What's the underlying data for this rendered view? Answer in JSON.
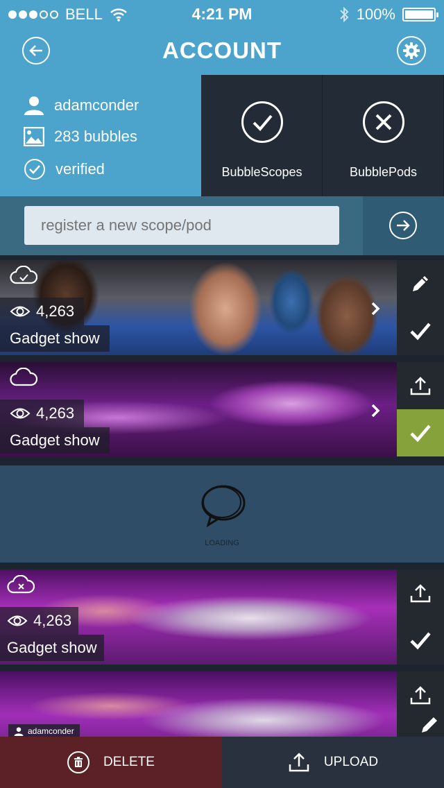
{
  "status_bar": {
    "carrier": "BELL",
    "time": "4:21 PM",
    "battery": "100%"
  },
  "header": {
    "title": "ACCOUNT"
  },
  "account": {
    "username": "adamconder",
    "bubbles": "283 bubbles",
    "verified": "verified"
  },
  "tiles": [
    {
      "label": "BubbleScopes",
      "icon": "check-circle-icon"
    },
    {
      "label": "BubblePods",
      "icon": "x-circle-icon"
    }
  ],
  "register": {
    "placeholder": "register a new scope/pod"
  },
  "cards": [
    {
      "views": "4,263",
      "title": "Gadget show"
    },
    {
      "views": "4,263",
      "title": "Gadget show"
    },
    {
      "views": "4,263",
      "title": "Gadget show"
    }
  ],
  "loading": {
    "label": "LOADING"
  },
  "card4_user": "adamconder",
  "bottom": {
    "delete_label": "DELETE",
    "upload_label": "UPLOAD"
  },
  "colors": {
    "header": "#4ca3cb",
    "dark_tile": "#232b37",
    "green": "#86a23a",
    "delete": "#5c2126"
  }
}
